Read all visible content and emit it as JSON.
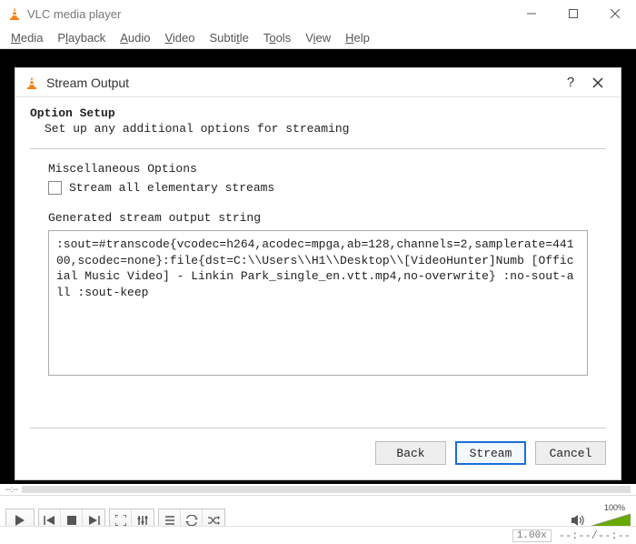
{
  "window": {
    "title": "VLC media player"
  },
  "menubar": {
    "media": "Media",
    "playback": "Playback",
    "audio": "Audio",
    "video": "Video",
    "subtitle": "Subtitle",
    "tools": "Tools",
    "view": "View",
    "help": "Help"
  },
  "dialog": {
    "title": "Stream Output",
    "heading": "Option Setup",
    "subheading": "Set up any additional options for streaming",
    "misc_label": "Miscellaneous Options",
    "stream_all_label": "Stream all elementary streams",
    "stream_all_checked": false,
    "gen_label": "Generated stream output string",
    "output_string": ":sout=#transcode{vcodec=h264,acodec=mpga,ab=128,channels=2,samplerate=44100,scodec=none}:file{dst=C:\\\\Users\\\\H1\\\\Desktop\\\\[VideoHunter]Numb [Official Music Video] - Linkin Park_single_en.vtt.mp4,no-overwrite} :no-sout-all :sout-keep",
    "buttons": {
      "back": "Back",
      "stream": "Stream",
      "cancel": "Cancel"
    }
  },
  "seek": {
    "elapsed": "--:--"
  },
  "volume": {
    "percent": "100%"
  },
  "status": {
    "speed": "1.00x",
    "time": "--:--/--:--"
  }
}
